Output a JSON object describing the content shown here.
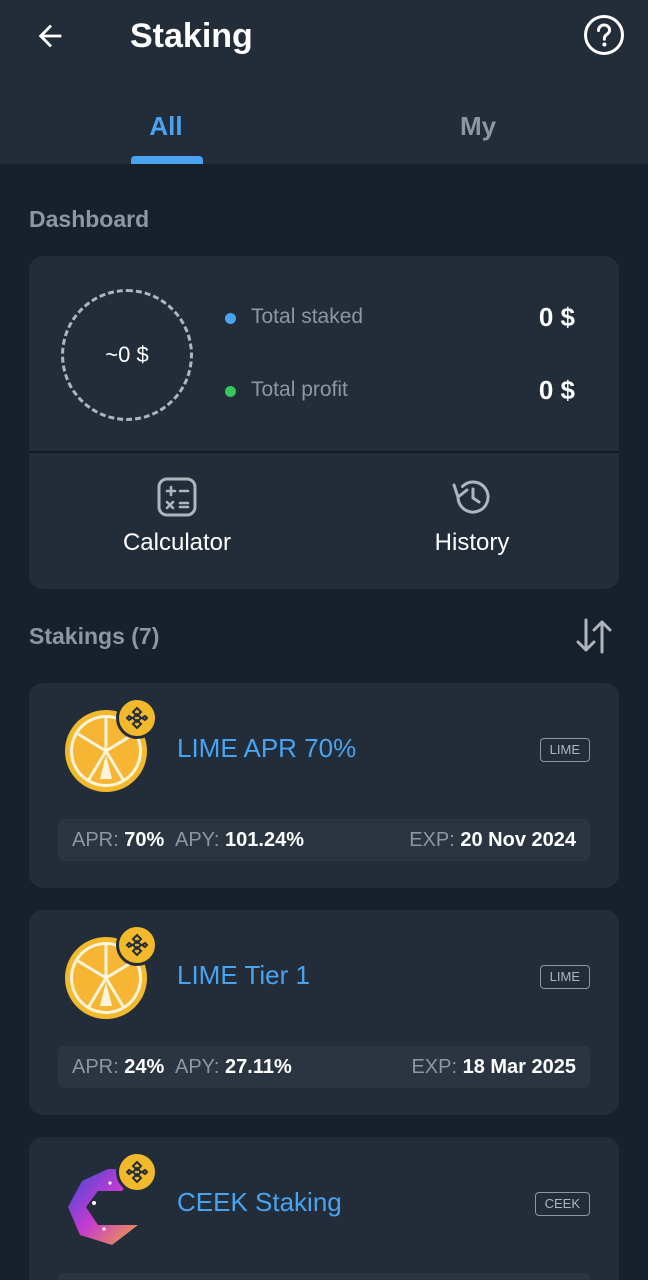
{
  "header": {
    "title": "Staking",
    "tabs": [
      {
        "label": "All",
        "active": true
      },
      {
        "label": "My",
        "active": false
      }
    ]
  },
  "dashboard": {
    "section_label": "Dashboard",
    "ring_value": "~0 $",
    "rows": [
      {
        "label": "Total staked",
        "value": "0 $",
        "dot_color": "#4aa3f0"
      },
      {
        "label": "Total profit",
        "value": "0 $",
        "dot_color": "#35c759"
      }
    ],
    "actions": [
      {
        "label": "Calculator",
        "icon": "calculator-icon"
      },
      {
        "label": "History",
        "icon": "history-icon"
      }
    ]
  },
  "stakings": {
    "section_label": "Stakings (7)",
    "apr_key": "APR:",
    "apy_key": "APY:",
    "exp_key": "EXP:",
    "items": [
      {
        "name": "LIME APR 70%",
        "ticker": "LIME",
        "apr": "70%",
        "apy": "101.24%",
        "exp": "20 Nov 2024",
        "coin": "lime-coin-icon"
      },
      {
        "name": "LIME Tier 1",
        "ticker": "LIME",
        "apr": "24%",
        "apy": "27.11%",
        "exp": "18 Mar 2025",
        "coin": "lime-coin-icon"
      },
      {
        "name": "CEEK Staking",
        "ticker": "CEEK",
        "apr": "",
        "apy": "",
        "exp": "",
        "coin": "ceek-coin-icon"
      }
    ]
  },
  "colors": {
    "accent": "#4aa3f0",
    "badge": "#f3b92c",
    "card_bg": "#222d39",
    "page_bg": "#18212b"
  }
}
